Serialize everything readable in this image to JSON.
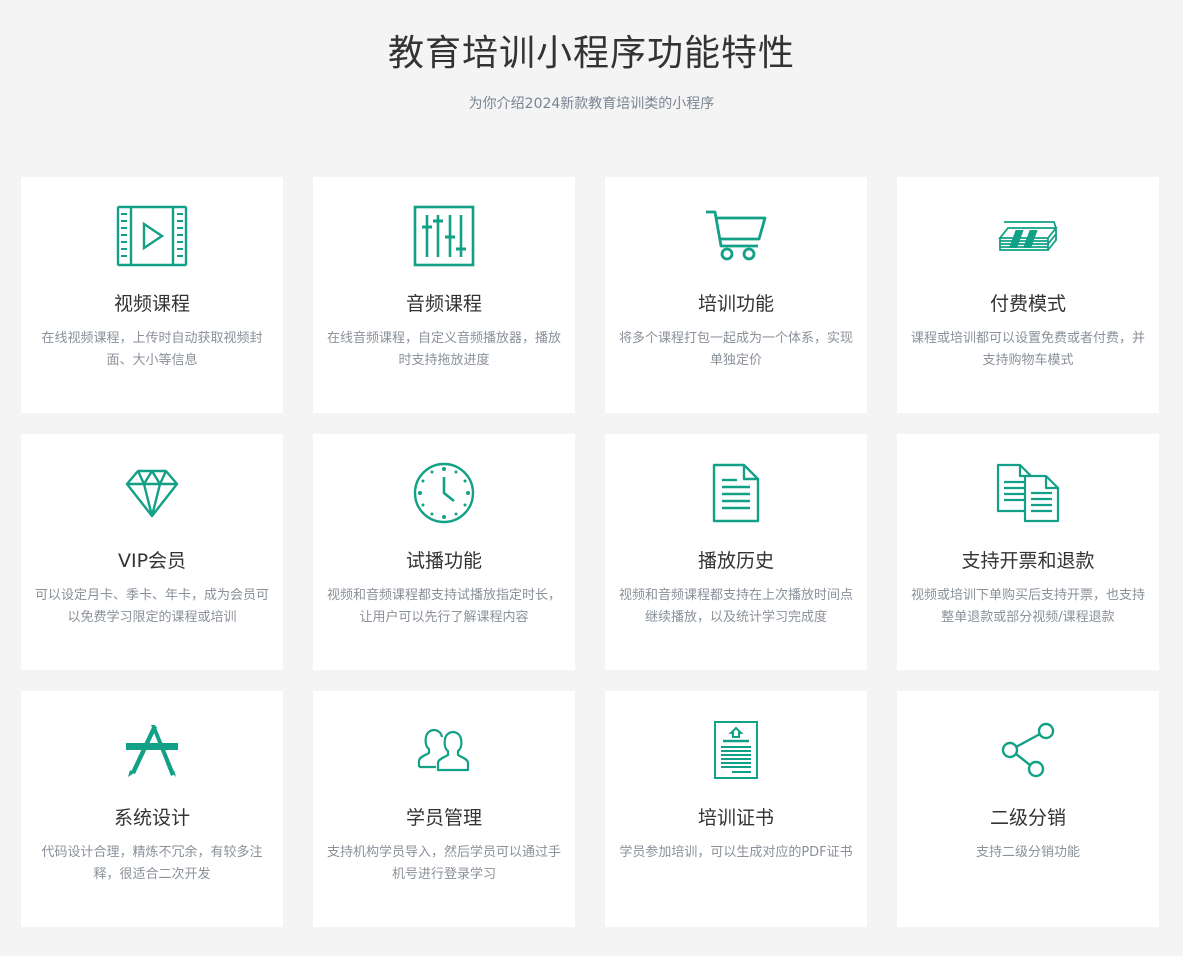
{
  "header": {
    "title": "教育培训小程序功能特性",
    "subtitle": "为你介绍2024新款教育培训类的小程序"
  },
  "accent_color": "#12a086",
  "features": [
    {
      "icon": "video-icon",
      "name": "视频课程",
      "desc": "在线视频课程，上传时自动获取视频封面、大小等信息"
    },
    {
      "icon": "audio-sliders-icon",
      "name": "音频课程",
      "desc": "在线音频课程，自定义音频播放器，播放时支持拖放进度"
    },
    {
      "icon": "cart-icon",
      "name": "培训功能",
      "desc": "将多个课程打包一起成为一个体系，实现单独定价"
    },
    {
      "icon": "money-stack-icon",
      "name": "付费模式",
      "desc": "课程或培训都可以设置免费或者付费，并支持购物车模式"
    },
    {
      "icon": "diamond-icon",
      "name": "VIP会员",
      "desc": "可以设定月卡、季卡、年卡，成为会员可以免费学习限定的课程或培训"
    },
    {
      "icon": "clock-icon",
      "name": "试播功能",
      "desc": "视频和音频课程都支持试播放指定时长，让用户可以先行了解课程内容"
    },
    {
      "icon": "document-icon",
      "name": "播放历史",
      "desc": "视频和音频课程都支持在上次播放时间点继续播放，以及统计学习完成度"
    },
    {
      "icon": "documents-icon",
      "name": "支持开票和退款",
      "desc": "视频或培训下单购买后支持开票，也支持整单退款或部分视频/课程退款"
    },
    {
      "icon": "design-tools-icon",
      "name": "系统设计",
      "desc": "代码设计合理，精炼不冗余，有较多注释，很适合二次开发"
    },
    {
      "icon": "users-icon",
      "name": "学员管理",
      "desc": "支持机构学员导入，然后学员可以通过手机号进行登录学习"
    },
    {
      "icon": "certificate-icon",
      "name": "培训证书",
      "desc": "学员参加培训，可以生成对应的PDF证书"
    },
    {
      "icon": "share-icon",
      "name": "二级分销",
      "desc": "支持二级分销功能"
    }
  ]
}
